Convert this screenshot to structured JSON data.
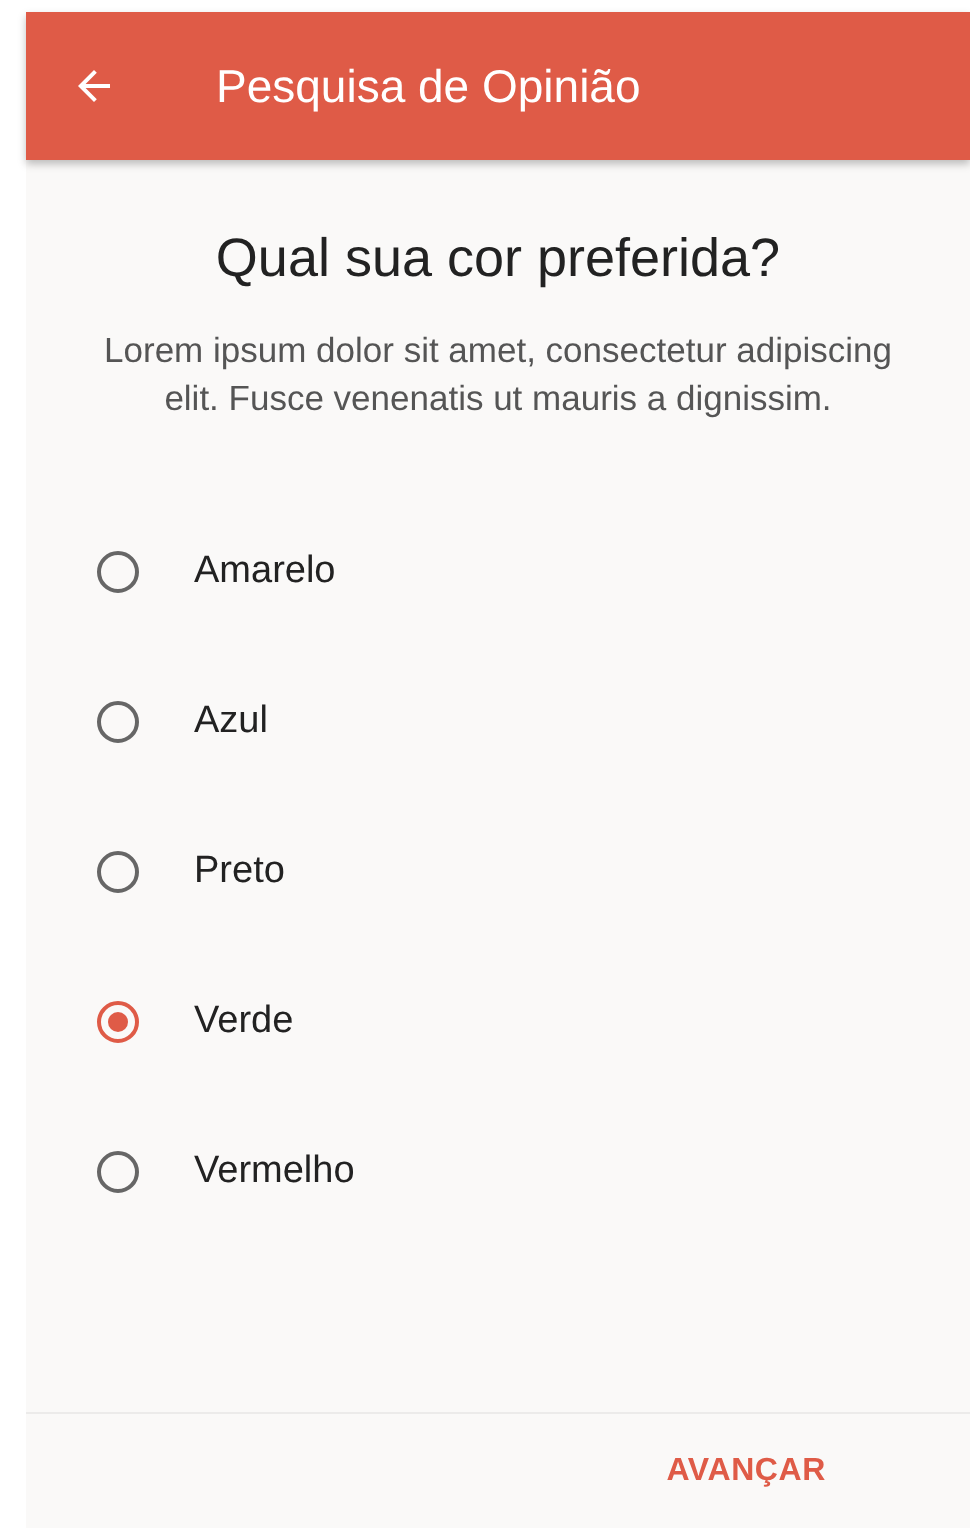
{
  "app_bar": {
    "title": "Pesquisa de Opinião"
  },
  "question": {
    "title": "Qual sua cor preferida?",
    "description": "Lorem ipsum dolor sit amet, consectetur adipiscing elit. Fusce venenatis ut mauris a dignissim."
  },
  "options": [
    {
      "label": "Amarelo",
      "selected": false
    },
    {
      "label": "Azul",
      "selected": false
    },
    {
      "label": "Preto",
      "selected": false
    },
    {
      "label": "Verde",
      "selected": true
    },
    {
      "label": "Vermelho",
      "selected": false
    }
  ],
  "footer": {
    "button": "AVANÇAR"
  }
}
